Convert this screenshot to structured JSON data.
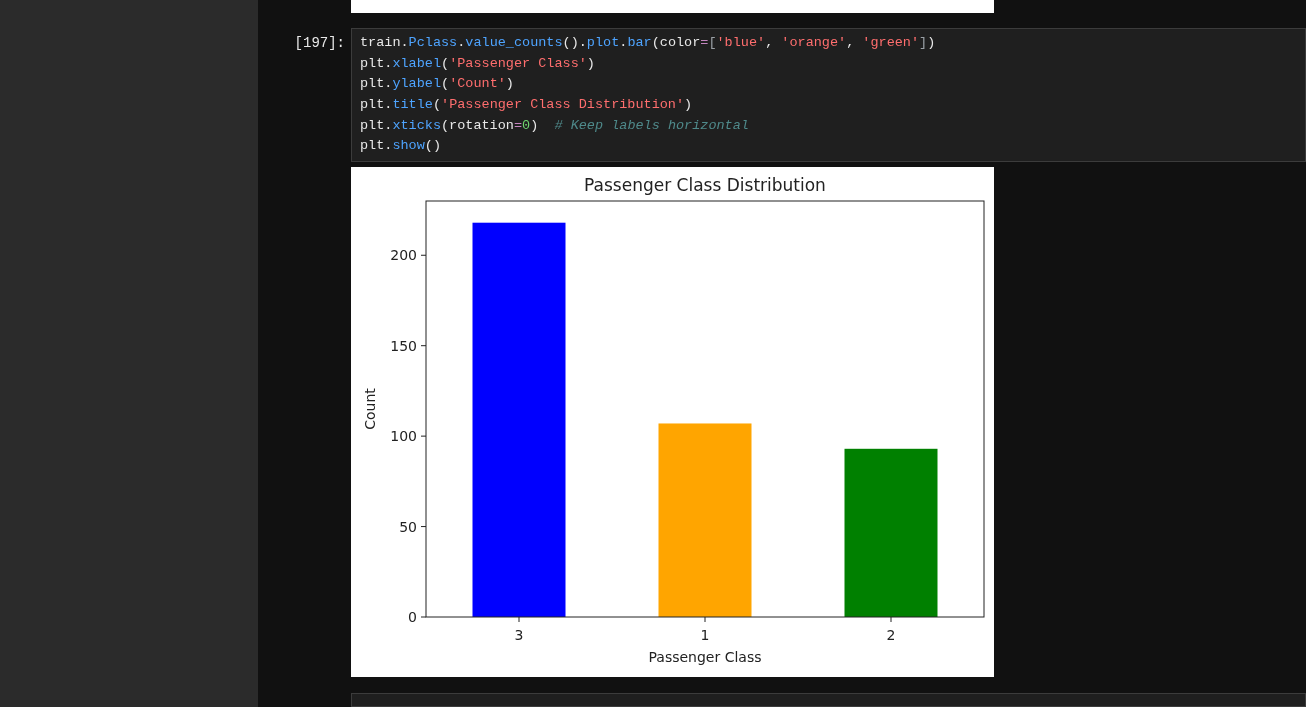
{
  "cell": {
    "prompt": "[197]:",
    "lines": [
      [
        {
          "kind": "plain",
          "text": "train."
        },
        {
          "kind": "attr",
          "text": "Pclass"
        },
        {
          "kind": "plain",
          "text": "."
        },
        {
          "kind": "attr",
          "text": "value_counts"
        },
        {
          "kind": "plain",
          "text": "()."
        },
        {
          "kind": "attr",
          "text": "plot"
        },
        {
          "kind": "plain",
          "text": "."
        },
        {
          "kind": "attr",
          "text": "bar"
        },
        {
          "kind": "plain",
          "text": "(color"
        },
        {
          "kind": "op",
          "text": "="
        },
        {
          "kind": "punct",
          "text": "["
        },
        {
          "kind": "string",
          "text": "'blue'"
        },
        {
          "kind": "plain",
          "text": ", "
        },
        {
          "kind": "string",
          "text": "'orange'"
        },
        {
          "kind": "plain",
          "text": ", "
        },
        {
          "kind": "string",
          "text": "'green'"
        },
        {
          "kind": "punct",
          "text": "]"
        },
        {
          "kind": "plain",
          "text": ")"
        }
      ],
      [
        {
          "kind": "plain",
          "text": "plt."
        },
        {
          "kind": "attr",
          "text": "xlabel"
        },
        {
          "kind": "plain",
          "text": "("
        },
        {
          "kind": "string",
          "text": "'Passenger Class'"
        },
        {
          "kind": "plain",
          "text": ")"
        }
      ],
      [
        {
          "kind": "plain",
          "text": "plt."
        },
        {
          "kind": "attr",
          "text": "ylabel"
        },
        {
          "kind": "plain",
          "text": "("
        },
        {
          "kind": "string",
          "text": "'Count'"
        },
        {
          "kind": "plain",
          "text": ")"
        }
      ],
      [
        {
          "kind": "plain",
          "text": "plt."
        },
        {
          "kind": "attr",
          "text": "title"
        },
        {
          "kind": "plain",
          "text": "("
        },
        {
          "kind": "string",
          "text": "'Passenger Class Distribution'"
        },
        {
          "kind": "plain",
          "text": ")"
        }
      ],
      [
        {
          "kind": "plain",
          "text": "plt."
        },
        {
          "kind": "attr",
          "text": "xticks"
        },
        {
          "kind": "plain",
          "text": "(rotation"
        },
        {
          "kind": "op",
          "text": "="
        },
        {
          "kind": "number",
          "text": "0"
        },
        {
          "kind": "plain",
          "text": ")  "
        },
        {
          "kind": "comment",
          "text": "# Keep labels horizontal"
        }
      ],
      [
        {
          "kind": "plain",
          "text": "plt."
        },
        {
          "kind": "attr",
          "text": "show"
        },
        {
          "kind": "plain",
          "text": "()"
        }
      ]
    ]
  },
  "output": {
    "chart_data": {
      "type": "bar",
      "title": "Passenger Class Distribution",
      "xlabel": "Passenger Class",
      "ylabel": "Count",
      "categories": [
        "3",
        "1",
        "2"
      ],
      "values": [
        218,
        107,
        93
      ],
      "colors": [
        "#0000ff",
        "#ffa500",
        "#008000"
      ],
      "ylim": [
        0,
        230
      ],
      "yticks": [
        0,
        50,
        100,
        150,
        200
      ]
    }
  }
}
